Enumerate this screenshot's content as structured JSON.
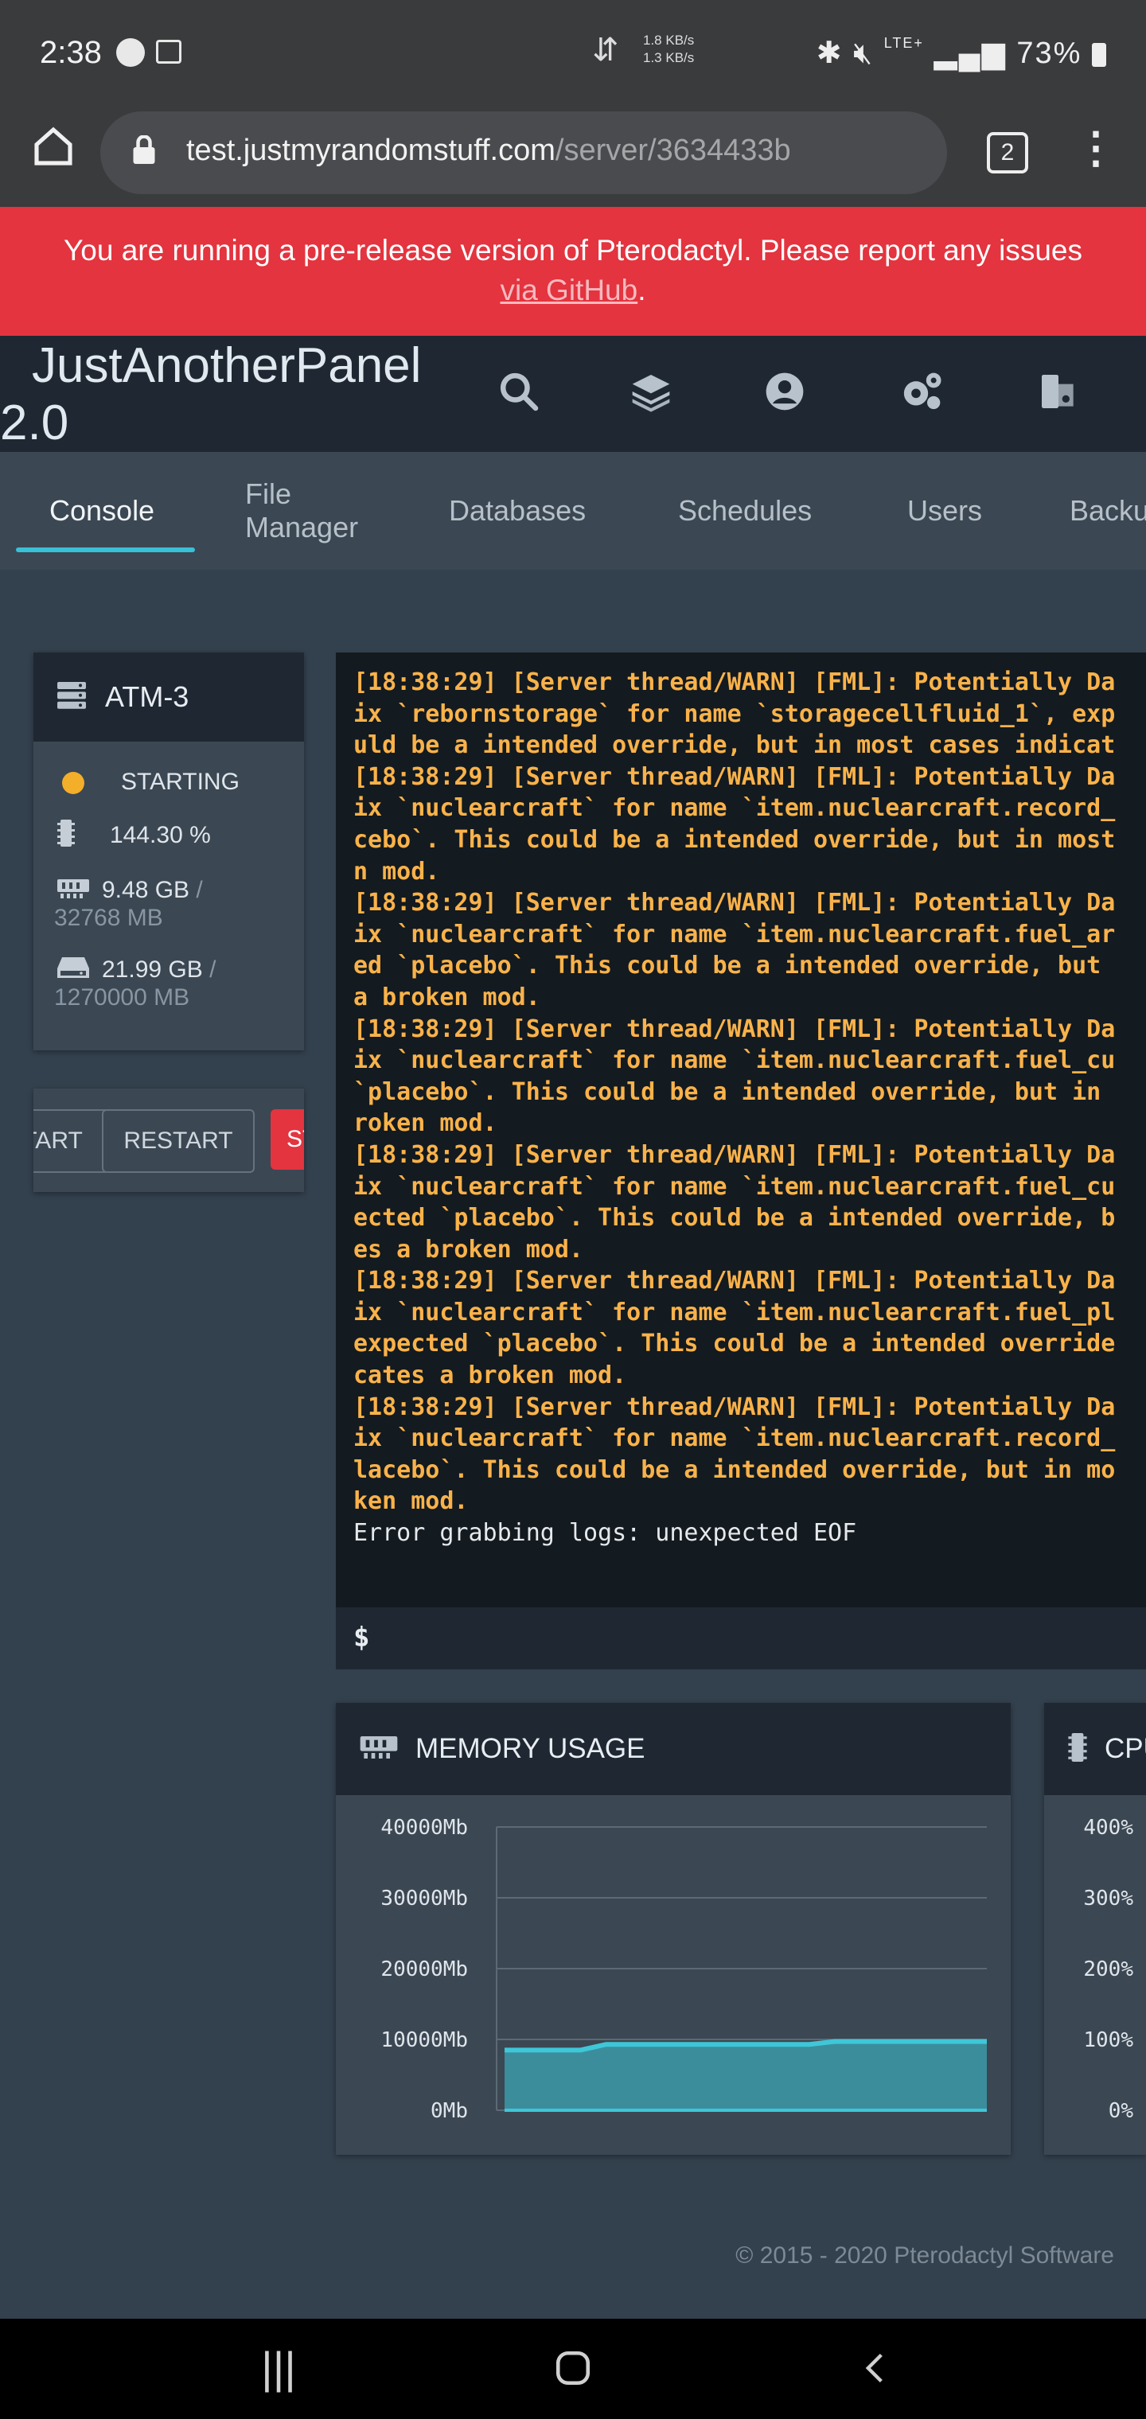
{
  "status_bar": {
    "time": "2:38",
    "net_up": "1.8 KB/s",
    "net_down": "1.3 KB/s",
    "signal": "LTE+",
    "battery": "73%"
  },
  "browser": {
    "url_host": "test.justmyrandomstuff.com",
    "url_path": "/server/3634433b",
    "tab_count": "2"
  },
  "banner": {
    "text": "You are running a pre-release version of Pterodactyl. Please report any issues",
    "link": "via GitHub",
    "suffix": "."
  },
  "header": {
    "brand_line1": "JustAnotherPanel",
    "brand_line2": "2.0",
    "icons": [
      "search-icon",
      "layers-icon",
      "user-circle-icon",
      "cogs-icon",
      "sign-out-icon"
    ]
  },
  "tabs": [
    "Console",
    "File Manager",
    "Databases",
    "Schedules",
    "Users",
    "Backups"
  ],
  "server": {
    "name": "ATM-3",
    "status": "STARTING",
    "cpu": "144.30 %",
    "memory_used": "9.48 GB",
    "memory_limit": "32768 MB",
    "disk_used": "21.99 GB",
    "disk_limit": "1270000 MB",
    "separator": "/"
  },
  "buttons": {
    "start": "START",
    "restart": "RESTART",
    "stop": "STOP"
  },
  "console": {
    "lines": [
      "[18:38:29] [Server thread/WARN] [FML]: Potentially Da",
      "ix `rebornstorage` for name `storagecellfluid_1`, exp",
      "uld be a intended override, but in most cases indicat",
      "[18:38:29] [Server thread/WARN] [FML]: Potentially Da",
      "ix `nuclearcraft` for name `item.nuclearcraft.record_",
      "cebo`. This could be a intended override, but in most",
      "n mod.",
      "[18:38:29] [Server thread/WARN] [FML]: Potentially Da",
      "ix `nuclearcraft` for name `item.nuclearcraft.fuel_ar",
      "ed `placebo`. This could be a intended override, but",
      "a broken mod.",
      "[18:38:29] [Server thread/WARN] [FML]: Potentially Da",
      "ix `nuclearcraft` for name `item.nuclearcraft.fuel_cu",
      "`placebo`. This could be a intended override, but in",
      "roken mod.",
      "[18:38:29] [Server thread/WARN] [FML]: Potentially Da",
      "ix `nuclearcraft` for name `item.nuclearcraft.fuel_cu",
      "ected `placebo`. This could be a intended override, b",
      "es a broken mod.",
      "[18:38:29] [Server thread/WARN] [FML]: Potentially Da",
      "ix `nuclearcraft` for name `item.nuclearcraft.fuel_pl",
      "expected `placebo`. This could be a intended override",
      "cates a broken mod.",
      "[18:38:29] [Server thread/WARN] [FML]: Potentially Da",
      "ix `nuclearcraft` for name `item.nuclearcraft.record_",
      "lacebo`. This could be a intended override, but in mo",
      "ken mod."
    ],
    "last_line": "Error grabbing logs: unexpected EOF",
    "prompt": "$"
  },
  "memory_graph": {
    "title": "MEMORY USAGE",
    "icon": "memory-icon"
  },
  "cpu_graph": {
    "title": "CPU USAGE",
    "icon": "microchip-icon"
  },
  "chart_data": [
    {
      "type": "area",
      "title": "MEMORY USAGE",
      "ylim": [
        0,
        40000
      ],
      "yticks": [
        "40000Mb",
        "30000Mb",
        "20000Mb",
        "10000Mb",
        "0Mb"
      ],
      "ytick_values": [
        40000,
        30000,
        20000,
        10000,
        0
      ],
      "x": [
        0,
        1,
        2,
        3,
        4,
        5,
        6,
        7,
        8,
        9,
        10,
        11,
        12,
        13,
        14,
        15,
        16,
        17,
        18,
        19
      ],
      "values": [
        8500,
        8500,
        8500,
        8500,
        9300,
        9300,
        9300,
        9300,
        9300,
        9300,
        9300,
        9300,
        9300,
        9700,
        9700,
        9700,
        9700,
        9700,
        9700,
        9700
      ],
      "color": "#3ec7d8",
      "grid": true
    },
    {
      "type": "area",
      "title": "CPU USAGE",
      "ylim": [
        0,
        400
      ],
      "yticks": [
        "400%",
        "300%",
        "200%",
        "100%",
        "0%"
      ],
      "ytick_values": [
        400,
        300,
        200,
        100,
        0
      ],
      "grid": true
    }
  ],
  "footer": "© 2015 - 2020 Pterodactyl Software"
}
